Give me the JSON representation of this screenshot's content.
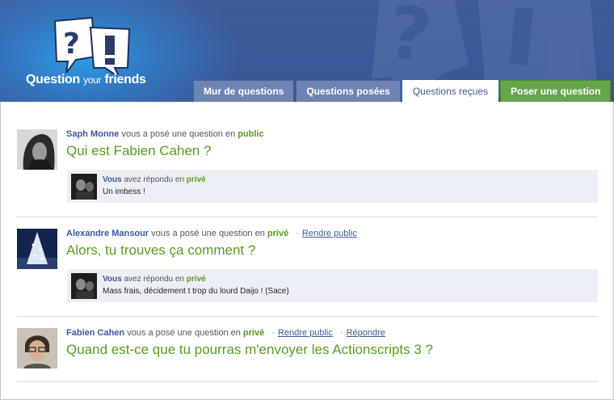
{
  "app": {
    "logo_word1": "Question",
    "logo_word2": "your",
    "logo_word3": "friends"
  },
  "tabs": [
    {
      "label": "Mur de questions",
      "active": false
    },
    {
      "label": "Questions posées",
      "active": false
    },
    {
      "label": "Questions reçues",
      "active": true
    },
    {
      "label": "Poser une question",
      "active": false
    }
  ],
  "colors": {
    "brand": "#3b5998",
    "accent_green": "#5a9a1f",
    "tab_green": "#67a54b"
  },
  "questions": [
    {
      "asker": "Saph Monne",
      "asked_text": "vous a posé une question en",
      "visibility": "public",
      "actions": [],
      "question": "Qui est Fabien Cahen ?",
      "answer": {
        "who": "Vous",
        "replied_text": "avez répondu en",
        "visibility": "privé",
        "text": "Un imbess !"
      }
    },
    {
      "asker": "Alexandre Mansour",
      "asked_text": "vous a posé une question en",
      "visibility": "privé",
      "actions": [
        "Rendre public"
      ],
      "question": "Alors, tu trouves ça comment ?",
      "answer": {
        "who": "Vous",
        "replied_text": "avez répondu en",
        "visibility": "privé",
        "text": "Mass frais, décidement t trop du lourd Daijo ! (Sace)"
      }
    },
    {
      "asker": "Fabien Cahen",
      "asked_text": "vous a posé une question en",
      "visibility": "privé",
      "actions": [
        "Rendre public",
        "Répondre"
      ],
      "question": "Quand est-ce que tu pourras m'envoyer les Actionscripts 3 ?",
      "answer": null
    }
  ]
}
